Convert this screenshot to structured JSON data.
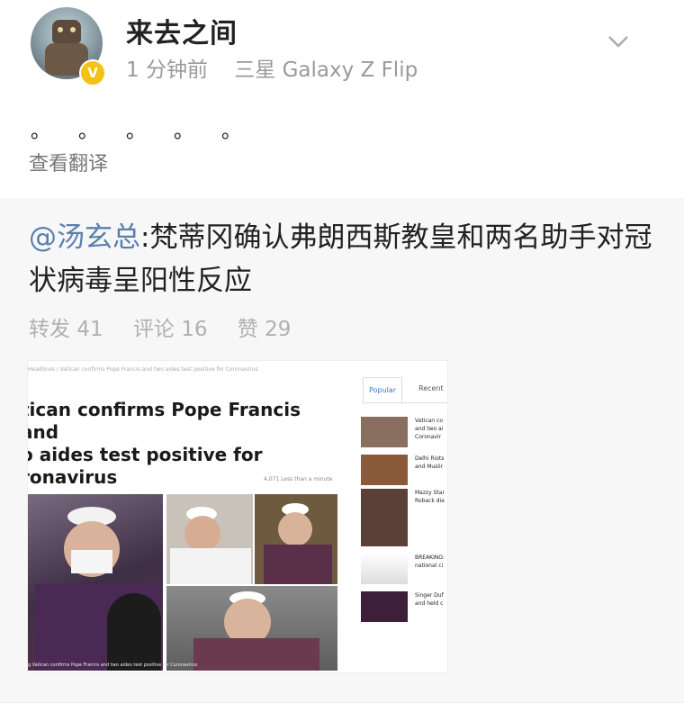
{
  "post": {
    "username": "来去之间",
    "verified_badge": "V",
    "time": "1 分钟前",
    "device": "三星 Galaxy Z Flip",
    "text": "。 。 。 。 。",
    "translate_label": "查看翻译",
    "menu_icon": "chevron-down-icon"
  },
  "repost": {
    "mention": "@汤玄总",
    "text": ":梵蒂冈确认弗朗西斯教皇和两名助手对冠状病毒呈阳性反应",
    "stats": {
      "forward": "转发 41",
      "comment": "评论 16",
      "like": "赞 29"
    }
  },
  "article": {
    "breadcrumb": "Headlines / Vatican confirms Pope Francis and two aides test positive for Coronavirus",
    "tabs": [
      "Popular",
      "Recent"
    ],
    "headline": "tican confirms Pope Francis and\no aides test positive for\nronavirus",
    "views": "4,071   Less than a minute",
    "caption": "g Vatican confirms Pope Francis and two aides test positive for Coronavirus",
    "sidebar": [
      {
        "title": "Vatican co\nand two ai\nCoronavir"
      },
      {
        "title": "Delhi Riots\nand Muslir"
      },
      {
        "title": "Mazzy Star\nRoback die"
      },
      {
        "title": "BREAKING:\nnational ci"
      },
      {
        "title": "Singer Duf\nand held c"
      }
    ]
  },
  "colors": {
    "mention": "#5a7fae",
    "badge": "#f4c114",
    "muted": "#9a9a9a",
    "repost_bg": "#f7f7f7"
  }
}
